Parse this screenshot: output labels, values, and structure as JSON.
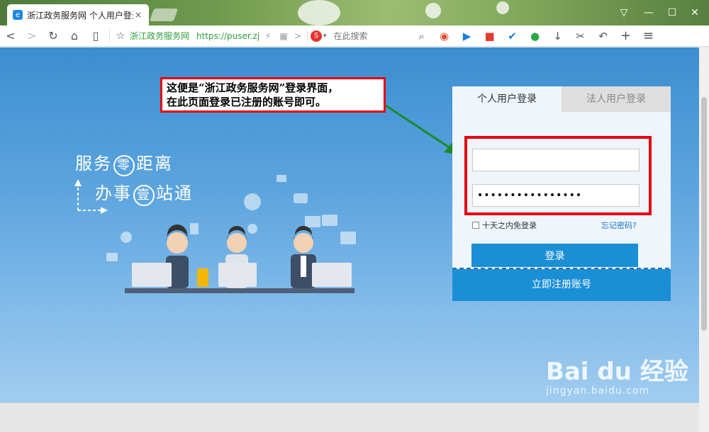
{
  "browser": {
    "tab_title": "浙江政务服务网 个人用户登录",
    "tab_favicon": "e",
    "tab_close": "×",
    "win_controls": {
      "skin": "▽",
      "minimize": "—",
      "maximize": "☐",
      "close": "✕"
    },
    "nav": {
      "back": "<",
      "forward": ">",
      "reload": "↻",
      "home": "⌂",
      "reader": "▯",
      "favorite": "☆"
    },
    "site_name": "浙江政务服务网",
    "url": "https://puser.zjzw",
    "url_extra": {
      "lightning": "⚡",
      "qr": "▦",
      "more": ">"
    },
    "search_engine_logo": "S",
    "search_placeholder": "在此搜索",
    "toolbar_icons": [
      "search-icon",
      "game-icon",
      "video-icon",
      "live-icon",
      "task-icon",
      "chat-icon",
      "download-icon",
      "cut-icon",
      "undo-icon",
      "add-icon",
      "menu-icon"
    ],
    "toolbar_glyphs": [
      "⌕",
      "◉",
      "▶",
      "■",
      "✔",
      "●",
      "↓",
      "✂",
      "↶",
      "+",
      "≡"
    ]
  },
  "slogan": {
    "line1_a": "服务",
    "line1_circle": "零",
    "line1_b": "距离",
    "line2_a": "办事",
    "line2_circle": "壹",
    "line2_b": "站通"
  },
  "annotation": {
    "line1": "这便是“浙江政务服务网”登录界面，",
    "line2": "在此页面登录已注册的账号即可。"
  },
  "login": {
    "tabs": [
      {
        "label": "个人用户登录",
        "active": true
      },
      {
        "label": "法人用户登录",
        "active": false
      }
    ],
    "username_value": "",
    "password_value": "••••••••••••••••",
    "remember_label": "十天之内免登录",
    "forgot_label": "忘记密码?",
    "login_button": "登录",
    "register_button": "立即注册账号"
  },
  "watermark": {
    "logo": "Bai du 经验",
    "sub": "jingyan.baidu.com"
  },
  "colors": {
    "accent": "#1b8fd6",
    "annotation_red": "#e60012",
    "arrow_green": "#1a8a2a",
    "site_green": "#2e9e3a"
  }
}
